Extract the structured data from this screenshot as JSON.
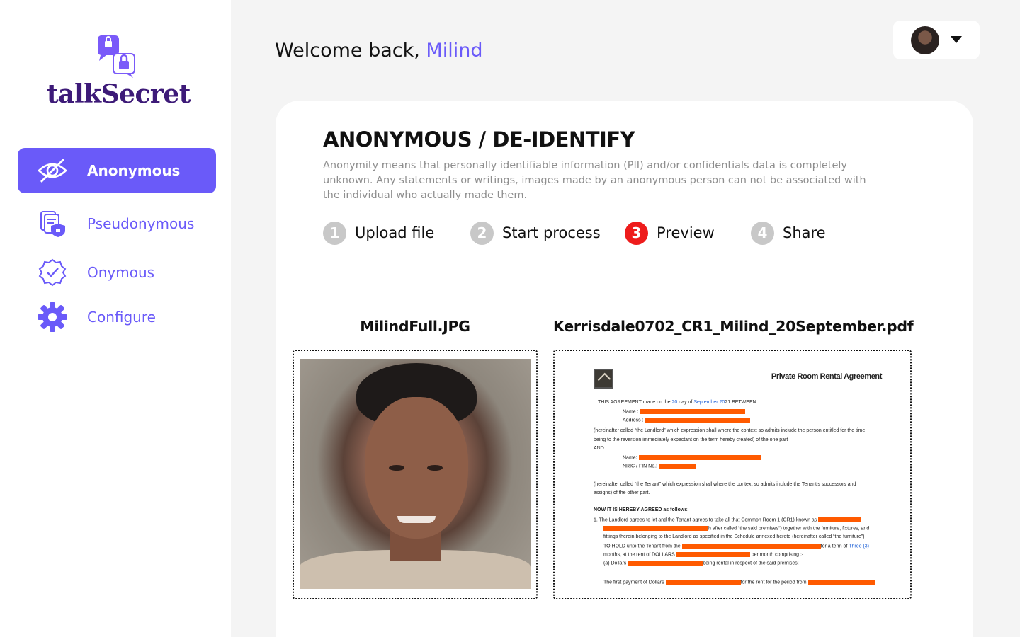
{
  "app": {
    "brand": "talkSecret"
  },
  "sidebar": {
    "items": [
      {
        "label": "Anonymous",
        "icon": "eye-slash-icon",
        "active": true
      },
      {
        "label": "Pseudonymous",
        "icon": "documents-shield-icon",
        "active": false
      },
      {
        "label": "Onymous",
        "icon": "verified-badge-icon",
        "active": false
      },
      {
        "label": "Configure",
        "icon": "gear-icon",
        "active": false
      }
    ]
  },
  "header": {
    "welcome_prefix": "Welcome back, ",
    "user_name": "Milind"
  },
  "card": {
    "title": "ANONYMOUS / DE-IDENTIFY",
    "description": "Anonymity means that personally identifiable information (PII) and/or confidentials data is completely unknown. Any statements or writings, images made by an anonymous person can not be associated with the individual who actually made them.",
    "steps": [
      {
        "num": "1",
        "label": "Upload file"
      },
      {
        "num": "2",
        "label": "Start process"
      },
      {
        "num": "3",
        "label": "Preview",
        "current": true
      },
      {
        "num": "4",
        "label": "Share"
      }
    ],
    "files": [
      {
        "name": "MilindFull.JPG"
      },
      {
        "name": "Kerrisdale0702_CR1_Milind_20September.pdf"
      }
    ]
  },
  "document": {
    "title": "Private Room Rental Agreement",
    "agreement_prefix": "THIS AGREEMENT made on the",
    "day": "20",
    "day_of": "day of",
    "month": "September",
    "year_prefix": "20",
    "year_suffix": "21",
    "between": "BETWEEN",
    "name_label": "Name :",
    "address_label": "Address :",
    "landlord_text_1": "(hereinafter called “the Landlord” which expression shall where the context so admits include the person entitled for the time",
    "landlord_text_2": "being to the reversion immediately expectant on the term hereby created) of the one part",
    "and": "AND",
    "tenant_name_label": "Name:",
    "nric_label": "NRIC / FIN No.:",
    "tenant_text_1": "(hereinafter called “the Tenant” which expression shall where the context so admits include the Tenant’s successors and",
    "tenant_text_2": "assigns) of the other part.",
    "agreed": "NOW IT IS HEREBY AGREED as follows:",
    "clause1_a": "1.    The Landlord agrees to let and the Tenant agrees to take all that Common Room 1 (CR1) known as",
    "clause1_b": "h after called “the said premises”) together with the furniture, fixtures, and",
    "clause1_c": "fittings therein belonging to the Landlord as specified in the Schedule annexed hereto (hereinafter called “the furniture”)",
    "clause1_d": "TO HOLD unto the Tenant from the",
    "clause1_term": "for a term of",
    "clause1_term_value": "Three (3)",
    "clause1_e": "months, at the rent of DOLLARS",
    "clause1_e2": "per month comprising :-",
    "clause1_f": "(a)   Dollars",
    "clause1_f2": "being rental in respect of the said premises;",
    "payment": "The first payment of Dollars",
    "payment2": "for the rent for the period from"
  },
  "colors": {
    "accent": "#6a5af9",
    "brand_text": "#3d1a78",
    "step_current": "#ee1c1c",
    "step_inactive": "#c8c8c8",
    "redaction": "#ff5a00"
  }
}
